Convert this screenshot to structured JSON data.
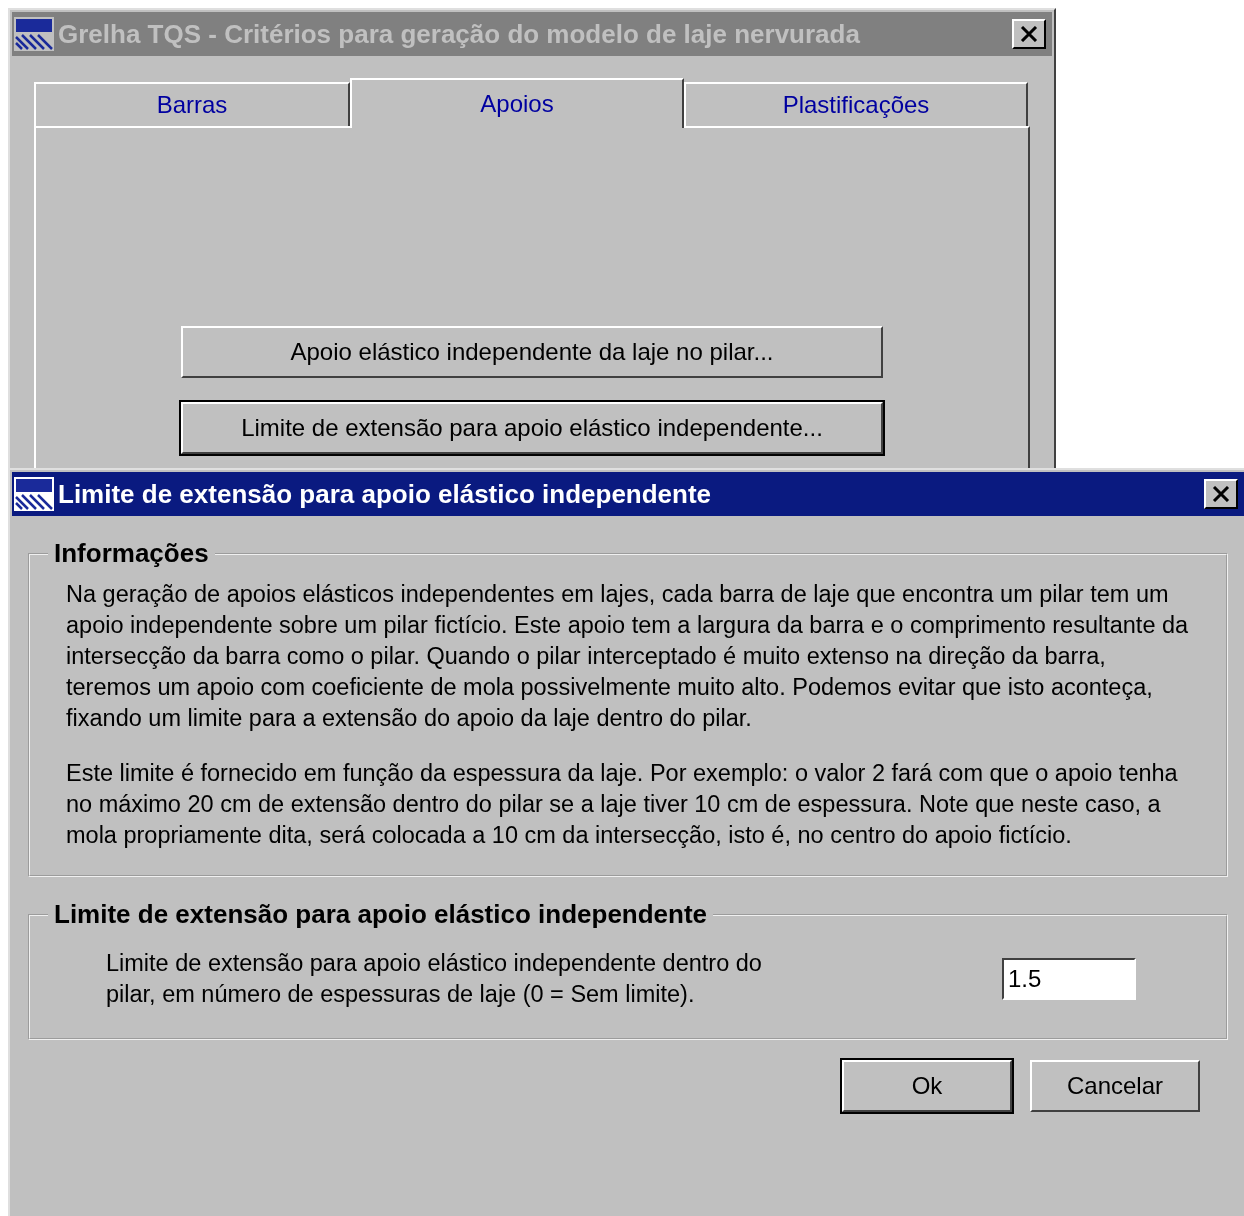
{
  "back_window": {
    "title": "Grelha TQS - Critérios para geração do modelo de laje nervurada",
    "active": false,
    "tabs": [
      {
        "label": "Barras",
        "selected": false
      },
      {
        "label": "Apoios",
        "selected": true
      },
      {
        "label": "Plastificações",
        "selected": false
      }
    ],
    "buttons": [
      {
        "label": "Apoio elástico independente da laje no pilar...",
        "focused": false
      },
      {
        "label": "Limite de extensão para apoio elástico independente...",
        "focused": true
      }
    ]
  },
  "dialog": {
    "title": "Limite de extensão para apoio elástico independente",
    "active": true,
    "info_group": {
      "title": "Informações",
      "paragraphs": [
        "Na geração de apoios elásticos independentes em lajes, cada barra de laje que encontra um pilar tem um apoio independente sobre um pilar fictício. Este apoio tem a largura da barra e o comprimento resultante da intersecção da barra como o pilar. Quando o pilar interceptado é muito extenso na direção da barra, teremos um apoio com coeficiente de mola possivelmente muito alto. Podemos evitar que isto aconteça, fixando um limite para a extensão do apoio da laje dentro do pilar.",
        "Este limite é fornecido em função da espessura da laje. Por exemplo: o valor 2 fará com que o apoio tenha no máximo 20 cm de extensão dentro do pilar se a laje tiver 10 cm de espessura. Note que neste caso, a mola propriamente dita, será colocada a 10 cm da intersecção, isto é, no centro do apoio fictício."
      ]
    },
    "limit_group": {
      "title": "Limite de extensão para apoio elástico independente",
      "label": "Limite de extensão para apoio elástico independente dentro do pilar, em número de espessuras de laje (0 = Sem limite).",
      "value": "1.5"
    },
    "buttons": [
      {
        "label": "Ok",
        "default": true
      },
      {
        "label": "Cancelar",
        "default": false
      }
    ]
  }
}
